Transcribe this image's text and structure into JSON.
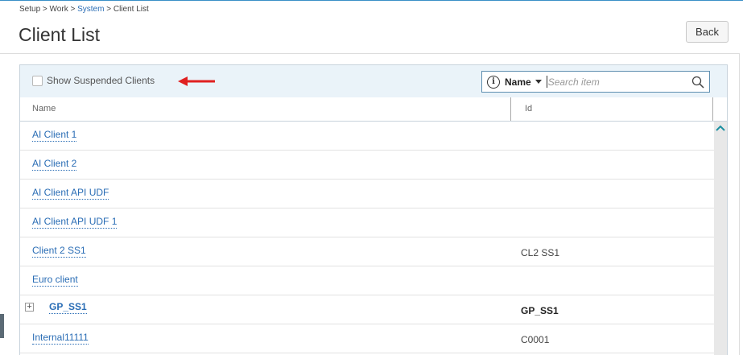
{
  "breadcrumb": {
    "parts": [
      "Setup",
      "Work",
      "System",
      "Client List"
    ],
    "separator": ">"
  },
  "page": {
    "title": "Client List"
  },
  "buttons": {
    "back_label": "Back"
  },
  "toolbar": {
    "show_suspended_label": "Show Suspended Clients",
    "show_suspended_checked": false
  },
  "search": {
    "field": "Name",
    "placeholder": "Search item",
    "value": ""
  },
  "table": {
    "columns": [
      "Name",
      "Id"
    ],
    "rows": [
      {
        "name": "AI Client 1",
        "id": ""
      },
      {
        "name": "AI Client 2",
        "id": ""
      },
      {
        "name": "AI Client API UDF",
        "id": ""
      },
      {
        "name": "AI Client API UDF 1",
        "id": ""
      },
      {
        "name": "Client 2 SS1",
        "id": "CL2 SS1"
      },
      {
        "name": "Euro client",
        "id": ""
      },
      {
        "name": "GP_SS1",
        "id": "GP_SS1",
        "expandable": true
      },
      {
        "name": "Internal11111",
        "id": "C0001"
      }
    ]
  },
  "colors": {
    "link": "#2a6db5",
    "annotation_arrow": "#e02020",
    "toolbar_bg": "#eaf3f9"
  },
  "icons": {
    "info": "info-icon",
    "search": "search-icon",
    "expand": "plus-box-icon",
    "scroll_up": "chevron-up-icon"
  }
}
